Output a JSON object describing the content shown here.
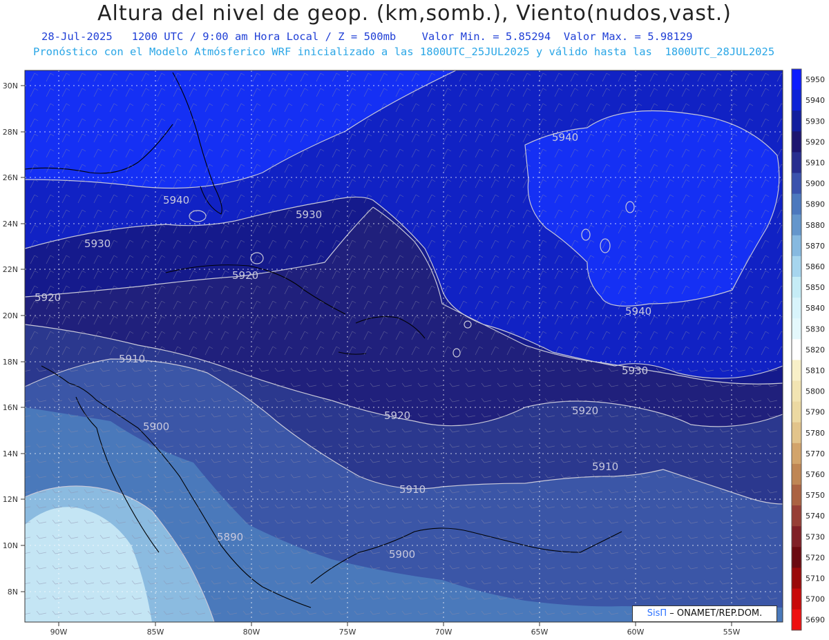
{
  "title": "Altura del nivel de geop. (km,somb.), Viento(nudos,vast.)",
  "subtitle_line1": "28-Jul-2025   1200 UTC / 9:00 am Hora Local / Z = 500mb    Valor Min. = 5.85294  Valor Max. = 5.98129",
  "subtitle_line2": "Pronóstico con el Modelo Atmósferico WRF inicializado a las 1800UTC_25JUL2025 y válido hasta las  1800UTC_28JUL2025",
  "lat_labels": [
    "30N",
    "28N",
    "26N",
    "24N",
    "22N",
    "20N",
    "18N",
    "16N",
    "14N",
    "12N",
    "10N",
    "8N"
  ],
  "lon_labels": [
    "90W",
    "85W",
    "80W",
    "75W",
    "70W",
    "65W",
    "60W",
    "55W"
  ],
  "contour_labels": [
    "5940",
    "5940",
    "5930",
    "5930",
    "5920",
    "5920",
    "5940",
    "5910",
    "5900",
    "5920",
    "5920",
    "5930",
    "5910",
    "5910",
    "5890",
    "5900"
  ],
  "colorbar": {
    "labels": [
      "5950",
      "5940",
      "5930",
      "5920",
      "5910",
      "5900",
      "5890",
      "5880",
      "5870",
      "5860",
      "5850",
      "5840",
      "5830",
      "5820",
      "5810",
      "5800",
      "5790",
      "5780",
      "5770",
      "5760",
      "5750",
      "5740",
      "5730",
      "5720",
      "5710",
      "5700",
      "5690"
    ],
    "colors": [
      "#0c1cff",
      "#0c22d6",
      "#121f9e",
      "#1d1670",
      "#272e8f",
      "#3a52ad",
      "#4c78be",
      "#6496cc",
      "#86b9e0",
      "#a6d5ee",
      "#c5ecf6",
      "#d8f4fb",
      "#e4f8fc",
      "#ffffff",
      "#f8f0c8",
      "#f2e4b2",
      "#ecd9a2",
      "#e2c48b",
      "#d2a46b",
      "#bf8654",
      "#ab6342",
      "#973f36",
      "#802026",
      "#6b0a10",
      "#9a0a0a",
      "#c80a0a",
      "#ee1010"
    ]
  },
  "credit": {
    "brand": "SisΠ",
    "text": "ONAMET/REP.DOM."
  },
  "colors": {
    "band_5950": "#1428f4",
    "band_5940": "#1222c6",
    "band_5930": "#161a8e",
    "band_5920": "#22207a",
    "band_5910": "#2d3990",
    "band_5900": "#3c57a8",
    "band_5890": "#4b7bbc",
    "band_5880": "#8fbde1",
    "band_5870": "#c4e5f4"
  }
}
